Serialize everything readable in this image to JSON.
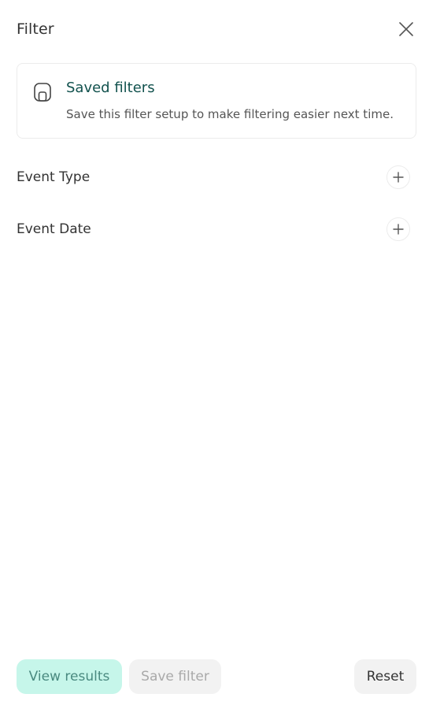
{
  "header": {
    "title": "Filter"
  },
  "saved_filters": {
    "title": "Saved filters",
    "description": "Save this filter setup to make filtering easier next time."
  },
  "filters": [
    {
      "label": "Event Type"
    },
    {
      "label": "Event Date"
    }
  ],
  "footer": {
    "view_results_label": "View results",
    "save_filter_label": "Save filter",
    "reset_label": "Reset"
  },
  "colors": {
    "accent_text": "#12524e",
    "primary_button_bg": "#c6f6ea",
    "primary_button_text": "#4a8a80",
    "secondary_button_bg": "#f2f2f2"
  },
  "icons": {
    "close": "close-icon",
    "saved": "save-icon",
    "add": "plus-icon"
  }
}
